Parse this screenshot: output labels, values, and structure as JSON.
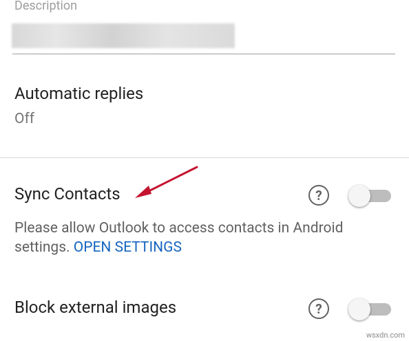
{
  "description": {
    "label": "Description"
  },
  "automatic_replies": {
    "title": "Automatic replies",
    "value": "Off"
  },
  "sync_contacts": {
    "title": "Sync Contacts",
    "help_icon": "question-circle-icon",
    "help_glyph": "?",
    "toggle_on": false,
    "note_text": "Please allow Outlook to access contacts in Android settings. ",
    "open_settings_link": "OPEN SETTINGS"
  },
  "block_external_images": {
    "title": "Block external images",
    "help_icon": "question-circle-icon",
    "help_glyph": "?",
    "toggle_on": false
  },
  "annotation": {
    "arrow_color": "#c4122f"
  },
  "watermark": "wsxdn.com",
  "colors": {
    "link": "#1565c0",
    "primary_text": "#212121",
    "secondary_text": "#757575"
  }
}
